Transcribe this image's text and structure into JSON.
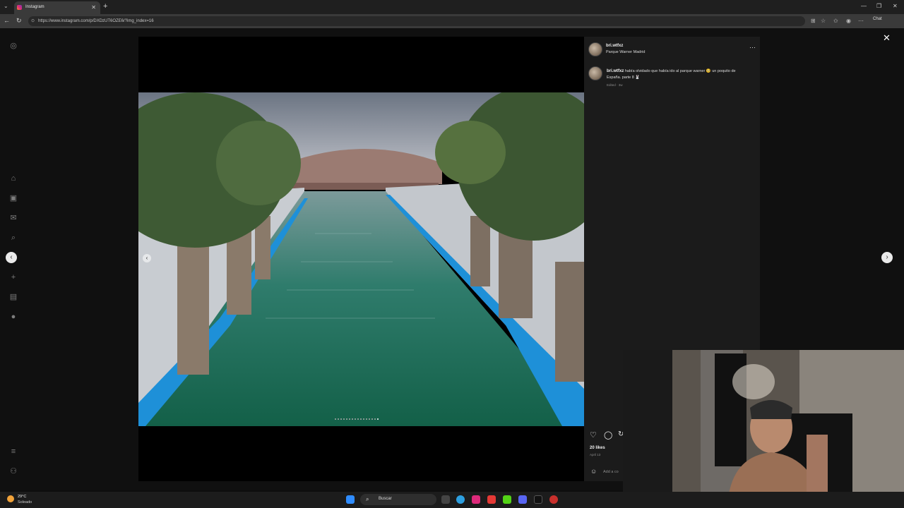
{
  "browser": {
    "tab_title": "Instagram",
    "url": "https://www.instagram.com/p/DXDzUT6OZE6/?img_index=16",
    "chat_label": "Chat"
  },
  "post": {
    "username": "bri.wtfxz",
    "location": "Parque Warner Madrid",
    "caption": "había olvidado que había ido al parque warner 🥺 un poquito de España. parte 8 🐰",
    "edited": "Edited · 3w",
    "likes": "20 likes",
    "date": "April 13",
    "add_comment_placeholder": "Add a co"
  },
  "taskbar": {
    "weather_temp": "29°C",
    "weather_desc": "Soleado",
    "search_label": "Buscar"
  },
  "icons": {
    "instagram": "instagram-logo-icon",
    "home": "home-icon",
    "reels": "reels-icon",
    "search": "search-icon",
    "create": "plus-icon",
    "dashboard": "dashboard-icon",
    "profile": "profile-icon",
    "menu": "hamburger-icon"
  },
  "colors": {
    "pool_blue": "#1e90d8",
    "water": "#1f6a55"
  }
}
